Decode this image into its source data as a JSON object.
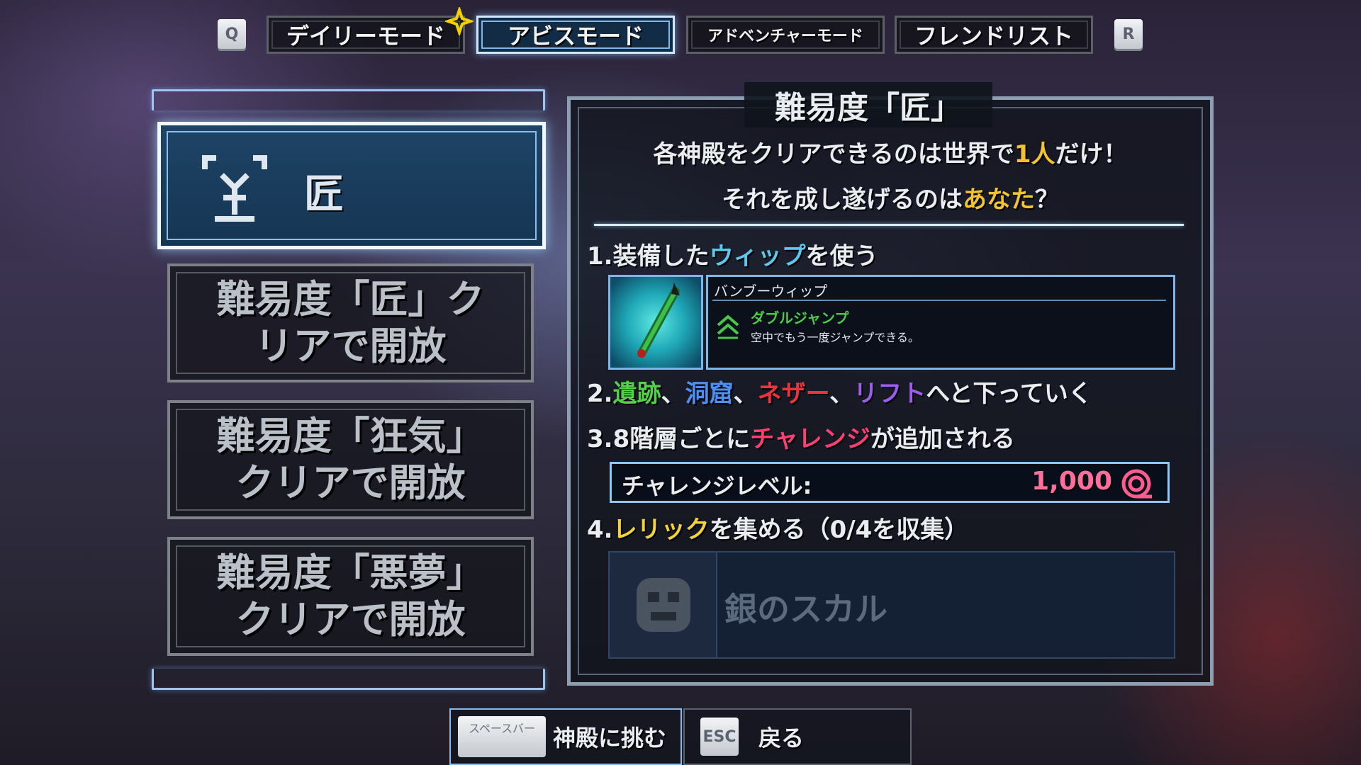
{
  "top_nav": {
    "left_key": "Q",
    "right_key": "R",
    "tabs": [
      {
        "label": "デイリーモード",
        "active": false,
        "badge_icon": "sparkle-icon"
      },
      {
        "label": "アビスモード",
        "active": true
      },
      {
        "label": "アドベンチャーモード",
        "active": false
      },
      {
        "label": "フレンドリスト",
        "active": false
      }
    ]
  },
  "difficulty_list": {
    "selected": {
      "label": "匠",
      "icon": "difficulty-tier-icon"
    },
    "locked": [
      {
        "line1": "難易度「匠」ク",
        "line2": "リアで開放"
      },
      {
        "line1": "難易度「狂気」",
        "line2": "クリアで開放"
      },
      {
        "line1": "難易度「悪夢」",
        "line2": "クリアで開放"
      }
    ]
  },
  "detail": {
    "title": "難易度「匠」",
    "intro_line1_a": "各神殿をクリアできるのは世界で",
    "intro_line1_hl": "1人",
    "intro_line1_b": "だけ！",
    "intro_line2_a": "それを成し遂げるのは",
    "intro_line2_hl": "あなた",
    "intro_line2_b": "？",
    "rule1": {
      "num": "1.",
      "a": "装備した",
      "hl": "ウィップ",
      "b": "を使う"
    },
    "item": {
      "name": "バンブーウィップ",
      "ability": "ダブルジャンプ",
      "ability_desc": "空中でもう一度ジャンプできる。"
    },
    "rule2": {
      "num": "2.",
      "w1": "遺跡",
      "sep1": "、",
      "w2": "洞窟",
      "sep2": "、",
      "w3": "ネザー",
      "sep3": "、",
      "w4": "リフト",
      "tail": "へと下っていく"
    },
    "rule3": {
      "num": "3.",
      "a": "8階層ごとに",
      "hl": "チャレンジ",
      "b": "が追加される"
    },
    "challenge": {
      "label": "チャレンジレベル:",
      "value": "1,000"
    },
    "rule4": {
      "num": "4.",
      "hl": "レリック",
      "b": "を集める（0/4を収集）"
    },
    "relic": {
      "name": "銀のスカル"
    }
  },
  "bottom": {
    "confirm_key": "スペースバー",
    "confirm_label": "神殿に挑む",
    "back_key": "ESC",
    "back_label": "戻る"
  },
  "colors": {
    "accent_gold": "#f4c430",
    "whip": "#5cc8f0",
    "ruins": "#54d048",
    "cave": "#4d8ff2",
    "nether": "#f0323c",
    "rift": "#a05cf0",
    "challenge": "#ff3e78",
    "relic": "#f2d33a"
  }
}
